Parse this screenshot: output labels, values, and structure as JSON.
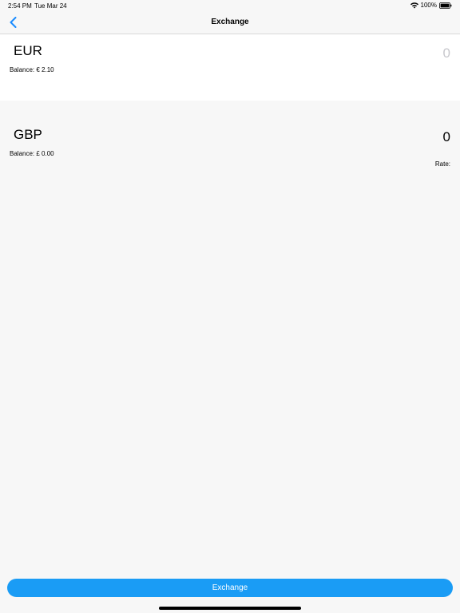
{
  "status_bar": {
    "time": "2:54 PM",
    "date": "Tue Mar 24",
    "battery": "100%",
    "icons": [
      "wifi-icon",
      "battery-icon"
    ]
  },
  "nav": {
    "title": "Exchange",
    "back_icon": "chevron-left-icon",
    "accent_color": "#1a8cff"
  },
  "from": {
    "currency": "EUR",
    "balance": "Balance: € 2.10",
    "amount_placeholder": "0",
    "amount_value": ""
  },
  "to": {
    "currency": "GBP",
    "balance": "Balance: £ 0.00",
    "amount": "0",
    "rate": "Rate:"
  },
  "exchange_button": {
    "label": "Exchange",
    "color": "#1a9cf5"
  }
}
